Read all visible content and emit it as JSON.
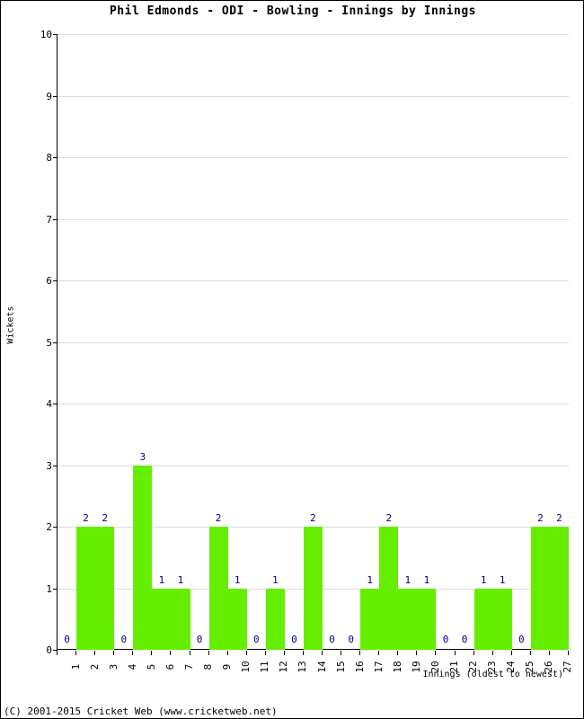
{
  "chart_data": {
    "type": "bar",
    "title": "Phil Edmonds - ODI - Bowling - Innings by Innings",
    "xlabel": "Innings (oldest to newest)",
    "ylabel": "Wickets",
    "ylim": [
      0,
      10
    ],
    "ytick_step": 1,
    "yticks": [
      "0",
      "1",
      "2",
      "3",
      "4",
      "5",
      "6",
      "7",
      "8",
      "9",
      "10"
    ],
    "grid": true,
    "grid_axis": "y",
    "legend": false,
    "bar_color": "#66ee00",
    "value_label_color": "#000080",
    "categories": [
      "1",
      "2",
      "3",
      "4",
      "5",
      "6",
      "7",
      "8",
      "9",
      "10",
      "11",
      "12",
      "13",
      "14",
      "15",
      "16",
      "17",
      "18",
      "19",
      "20",
      "21",
      "22",
      "23",
      "24",
      "25",
      "26",
      "27"
    ],
    "values": [
      0,
      2,
      2,
      0,
      3,
      1,
      1,
      0,
      2,
      1,
      0,
      1,
      0,
      2,
      0,
      0,
      1,
      2,
      1,
      1,
      0,
      0,
      1,
      1,
      0,
      2,
      2
    ],
    "value_labels": [
      "0",
      "2",
      "2",
      "0",
      "3",
      "1",
      "1",
      "0",
      "2",
      "1",
      "0",
      "1",
      "0",
      "2",
      "0",
      "0",
      "1",
      "2",
      "1",
      "1",
      "0",
      "0",
      "1",
      "1",
      "0",
      "2",
      "2"
    ]
  },
  "footer": {
    "credit": "(C) 2001-2015 Cricket Web (www.cricketweb.net)"
  }
}
